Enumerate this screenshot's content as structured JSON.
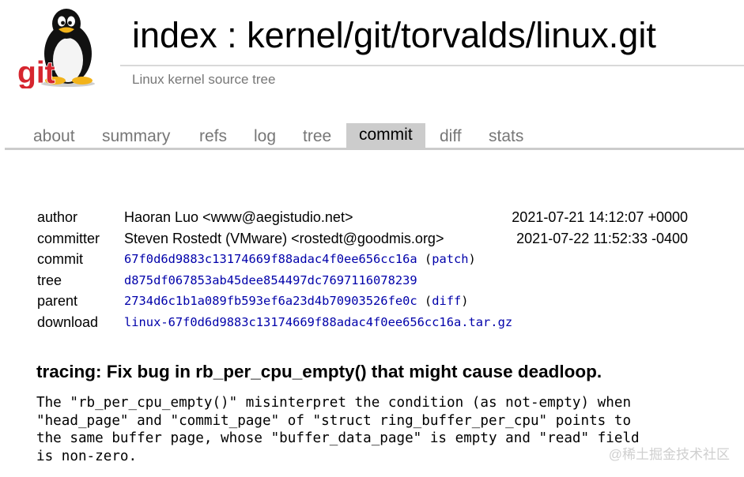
{
  "header": {
    "logo_text": "git",
    "title": "index : kernel/git/torvalds/linux.git",
    "description": "Linux kernel source tree"
  },
  "tabs": [
    {
      "label": "about"
    },
    {
      "label": "summary"
    },
    {
      "label": "refs"
    },
    {
      "label": "log"
    },
    {
      "label": "tree"
    },
    {
      "label": "commit",
      "active": true
    },
    {
      "label": "diff"
    },
    {
      "label": "stats"
    }
  ],
  "commit_info": {
    "author": {
      "label": "author",
      "value": "Haoran Luo <www@aegistudio.net>",
      "date": "2021-07-21 14:12:07 +0000"
    },
    "committer": {
      "label": "committer",
      "value": "Steven Rostedt (VMware) <rostedt@goodmis.org>",
      "date": "2021-07-22 11:52:33 -0400"
    },
    "commit": {
      "label": "commit",
      "hash": "67f0d6d9883c13174669f88adac4f0ee656cc16a",
      "extra_link": "patch"
    },
    "tree": {
      "label": "tree",
      "hash": "d875df067853ab45dee854497dc7697116078239"
    },
    "parent": {
      "label": "parent",
      "hash": "2734d6c1b1a089fb593ef6a23d4b70903526fe0c",
      "extra_link": "diff"
    },
    "download": {
      "label": "download",
      "file": "linux-67f0d6d9883c13174669f88adac4f0ee656cc16a.tar.gz"
    }
  },
  "subject": "tracing: Fix bug in rb_per_cpu_empty() that might cause deadloop.",
  "message": "The \"rb_per_cpu_empty()\" misinterpret the condition (as not-empty) when\n\"head_page\" and \"commit_page\" of \"struct ring_buffer_per_cpu\" points to\nthe same buffer page, whose \"buffer_data_page\" is empty and \"read\" field\nis non-zero.",
  "watermark": "@稀土掘金技术社区",
  "colors": {
    "link": "#0000aa",
    "muted": "#777777",
    "active_tab_bg": "#cccccc",
    "logo_red": "#d6262f"
  }
}
